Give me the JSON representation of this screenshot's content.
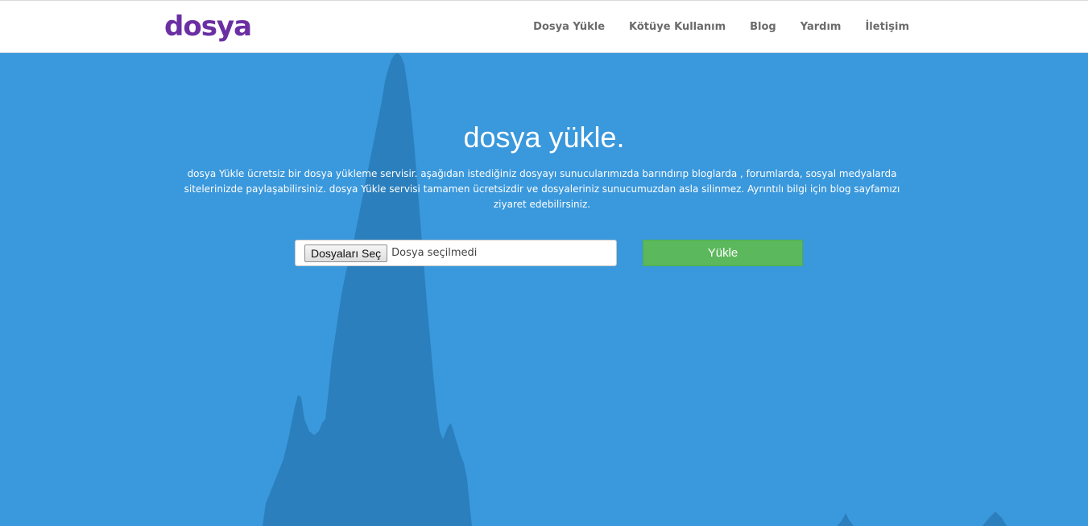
{
  "header": {
    "logo_text": "dosya",
    "nav": [
      {
        "label": "Dosya Yükle"
      },
      {
        "label": "Kötüye Kullanım"
      },
      {
        "label": "Blog"
      },
      {
        "label": "Yardım"
      },
      {
        "label": "İletişim"
      }
    ]
  },
  "hero": {
    "title": "dosya yükle.",
    "description": "dosya Yükle ücretsiz bir dosya yükleme servisir. aşağıdan istediğiniz dosyayı sunucularımızda barındırıp bloglarda , forumlarda, sosyal medyalarda sitelerinizde paylaşabilirsiniz. dosya Yükle servisi tamamen ücretsizdir ve dosyaleriniz sunucumuzdan asla silinmez. Ayrıntılı bilgi için blog sayfamızı ziyaret edebilirsiniz."
  },
  "upload": {
    "choose_label": "Dosyaları Seç",
    "status": "Dosya seçilmedi",
    "submit_label": "Yükle"
  },
  "colors": {
    "background": "#3a98dc",
    "silhouette": "#2b7fbd",
    "brand": "#6b2fa3",
    "submit": "#5cb85c"
  }
}
